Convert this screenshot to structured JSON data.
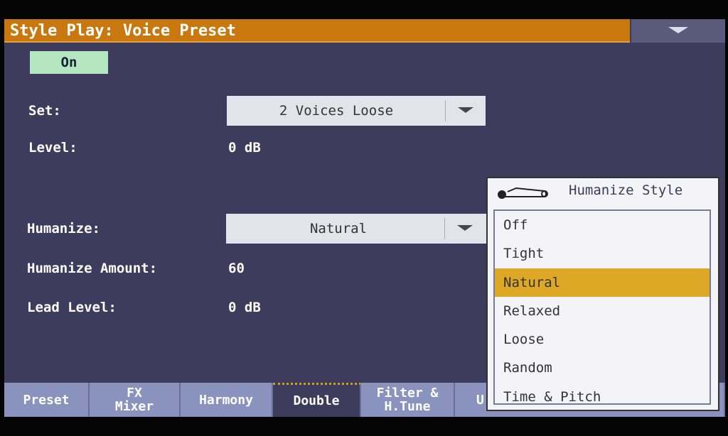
{
  "header": {
    "title": "Style Play: Voice Preset",
    "menu_icon": "triangle-down-icon"
  },
  "on_button": "On",
  "fields": {
    "set": {
      "label": "Set:",
      "value": "2 Voices Loose"
    },
    "level": {
      "label": "Level:",
      "value": "0 dB"
    },
    "humanize": {
      "label": "Humanize:",
      "value": "Natural"
    },
    "humanize_amount": {
      "label": "Humanize Amount:",
      "value": "60"
    },
    "lead_level": {
      "label": "Lead Level:",
      "value": "0 dB"
    }
  },
  "tabs": [
    {
      "label": "Preset"
    },
    {
      "label": "FX Mixer"
    },
    {
      "label": "Harmony"
    },
    {
      "label": "Double",
      "selected": true
    },
    {
      "label": "Filter & H.Tune"
    },
    {
      "label": "U"
    }
  ],
  "popup": {
    "title": "Humanize Style",
    "icon": "safety-pin-icon",
    "selected": "Natural",
    "items": [
      "Off",
      "Tight",
      "Natural",
      "Relaxed",
      "Loose",
      "Random",
      "Time & Pitch"
    ]
  },
  "colors": {
    "title_bar": "#c8780e",
    "background": "#3d3c5d",
    "selection": "#dca826",
    "on_button": "#b4e6c0"
  }
}
